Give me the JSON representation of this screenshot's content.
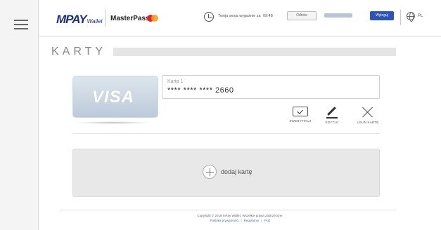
{
  "header": {
    "logo_mpay": "MPAY",
    "logo_wallet": "Wallet",
    "logo_masterpass": "MasterPass",
    "session_text": "Twoja sesja wygaśnie za",
    "session_time": "09:48",
    "refresh_label": "Odnów",
    "logout_label": "Wyloguj",
    "language": "PL"
  },
  "page": {
    "title": "KARTY"
  },
  "card": {
    "brand": "VISA",
    "name": "Karta 1",
    "number_masked": "**** **** ****",
    "number_last4": "2660",
    "actions": {
      "verify_label": "ZWERYFIKUJ",
      "edit_label": "EDYTUJ",
      "delete_label": "USUŃ KARTĘ"
    }
  },
  "add_card": {
    "label": "dodaj kartę"
  },
  "footer": {
    "copyright": "Copyright © 2016 mPay Wallet. Wszelkie prawa zastrzeżone.",
    "links": {
      "privacy": "Polityka prywatności",
      "sep1": "|",
      "terms": "Regulamin",
      "sep2": "|",
      "faq": "FAQ"
    }
  },
  "colors": {
    "brand_blue": "#1b2f7a",
    "logout_button": "#2d54b5",
    "link": "#4a6cc7",
    "mastercard_red": "#e5212b",
    "mastercard_yellow": "#f59e1a"
  }
}
